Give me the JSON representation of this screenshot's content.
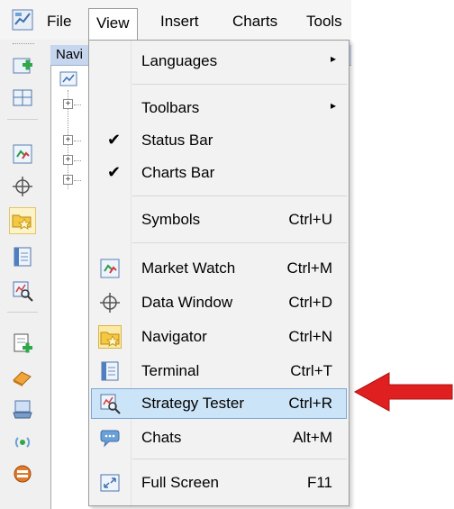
{
  "menubar": {
    "items": [
      {
        "label": "File",
        "active": false
      },
      {
        "label": "View",
        "active": true
      },
      {
        "label": "Insert",
        "active": false
      },
      {
        "label": "Charts",
        "active": false
      },
      {
        "label": "Tools",
        "active": false
      }
    ]
  },
  "navigator": {
    "title": "Navi"
  },
  "view_menu": {
    "items": [
      {
        "label": "Languages",
        "shortcut": "",
        "submenu": true
      },
      {
        "label": "Toolbars",
        "shortcut": "",
        "submenu": true
      },
      {
        "label": "Status Bar",
        "shortcut": "",
        "checked": true
      },
      {
        "label": "Charts Bar",
        "shortcut": "",
        "checked": true
      },
      {
        "label": "Symbols",
        "shortcut": "Ctrl+U"
      },
      {
        "label": "Market Watch",
        "shortcut": "Ctrl+M",
        "icon": "market-watch-icon"
      },
      {
        "label": "Data Window",
        "shortcut": "Ctrl+D",
        "icon": "crosshair-icon"
      },
      {
        "label": "Navigator",
        "shortcut": "Ctrl+N",
        "icon": "navigator-folder-icon"
      },
      {
        "label": "Terminal",
        "shortcut": "Ctrl+T",
        "icon": "terminal-icon"
      },
      {
        "label": "Strategy Tester",
        "shortcut": "Ctrl+R",
        "icon": "strategy-tester-icon",
        "highlighted": true
      },
      {
        "label": "Chats",
        "shortcut": "Alt+M",
        "icon": "chat-bubble-icon"
      },
      {
        "label": "Full Screen",
        "shortcut": "F11",
        "icon": "fullscreen-icon"
      }
    ]
  },
  "annotation": {
    "arrow_color": "#e02020",
    "points_to": "Strategy Tester"
  },
  "colors": {
    "highlight_bg": "#cce4f7",
    "highlight_border": "#7ea7d6",
    "nav_title_bg": "#c6d6ee"
  }
}
